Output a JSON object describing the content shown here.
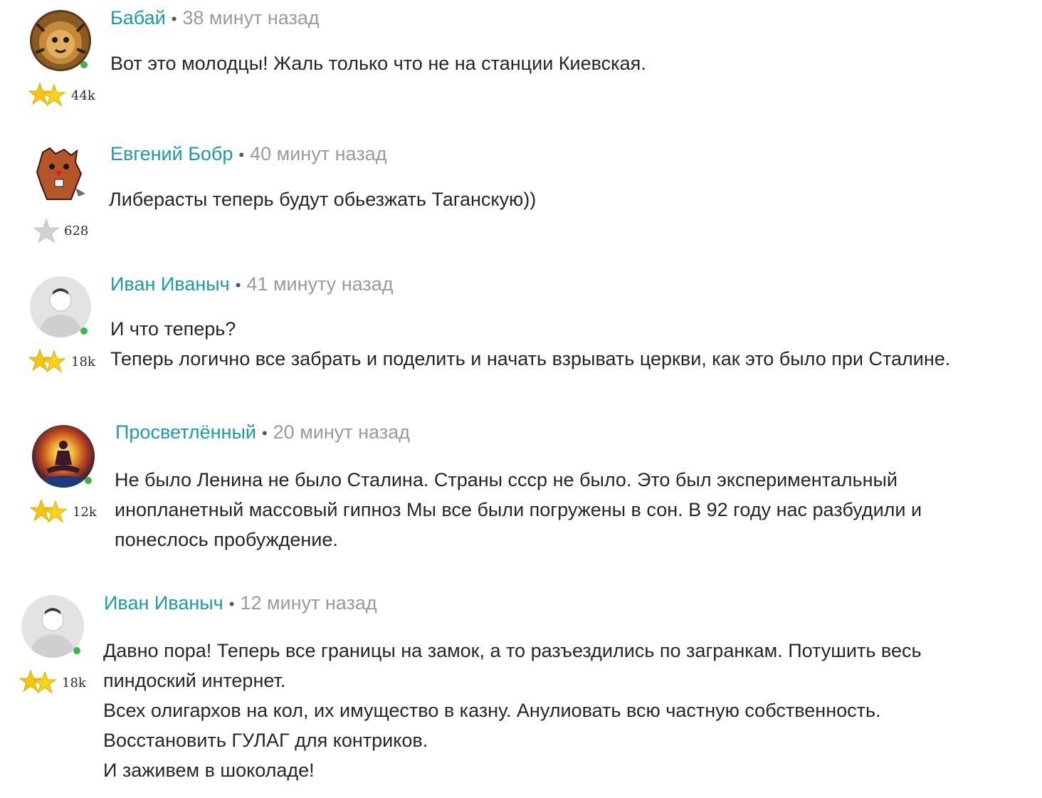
{
  "comments": [
    {
      "author": "Бабай",
      "time": "38 минут назад",
      "rating": "44k",
      "star_style": "gold",
      "lines": [
        "Вот это молодцы! Жаль только что не на станции Киевская."
      ]
    },
    {
      "author": "Евгений Бобр",
      "time": "40 минут назад",
      "rating": "628",
      "star_style": "grey",
      "lines": [
        "Либерасты теперь будут обьезжать Таганскую))"
      ]
    },
    {
      "author": "Иван Иваныч",
      "time": "41 минуту назад",
      "rating": "18k",
      "star_style": "gold",
      "lines": [
        "И что теперь?",
        "Теперь логично все забрать и поделить и начать взрывать церкви, как это было при Сталине."
      ]
    },
    {
      "author": "Просветлённый",
      "time": "20 минут назад",
      "rating": "12k",
      "star_style": "gold",
      "lines": [
        "Не было Ленина не было Сталина. Страны ссср не было. Это был экспериментальный",
        "инопланетный массовый гипноз Мы все были погружены в сон. В 92 году нас разбудили и",
        "понеслось пробуждение."
      ]
    },
    {
      "author": "Иван Иваныч",
      "time": "12 минут назад",
      "rating": "18k",
      "star_style": "gold",
      "lines": [
        "Давно пора! Теперь все границы на замок, а то разъездились по загранкам. Потушить весь",
        "пиндоский интернет.",
        "Всех олигархов на кол, их имущество в казну. Анулиовать всю частную собственность.",
        "Восстановить ГУЛАГ для контриков.",
        "И заживем в шоколаде!"
      ]
    }
  ],
  "icons": {
    "avatar_1": "lion-avatar-icon",
    "avatar_2": "beaver-avatar-icon",
    "avatar_3": "default-user-avatar-icon",
    "avatar_4": "meditation-avatar-icon",
    "avatar_5": "default-user-avatar-icon",
    "rating": "star-icon"
  },
  "colors": {
    "author": "#1c9aa8",
    "time": "#9a9a9a",
    "online": "#3bb54a",
    "star_gold": "#f3c614",
    "star_grey": "#d2d2d2"
  }
}
